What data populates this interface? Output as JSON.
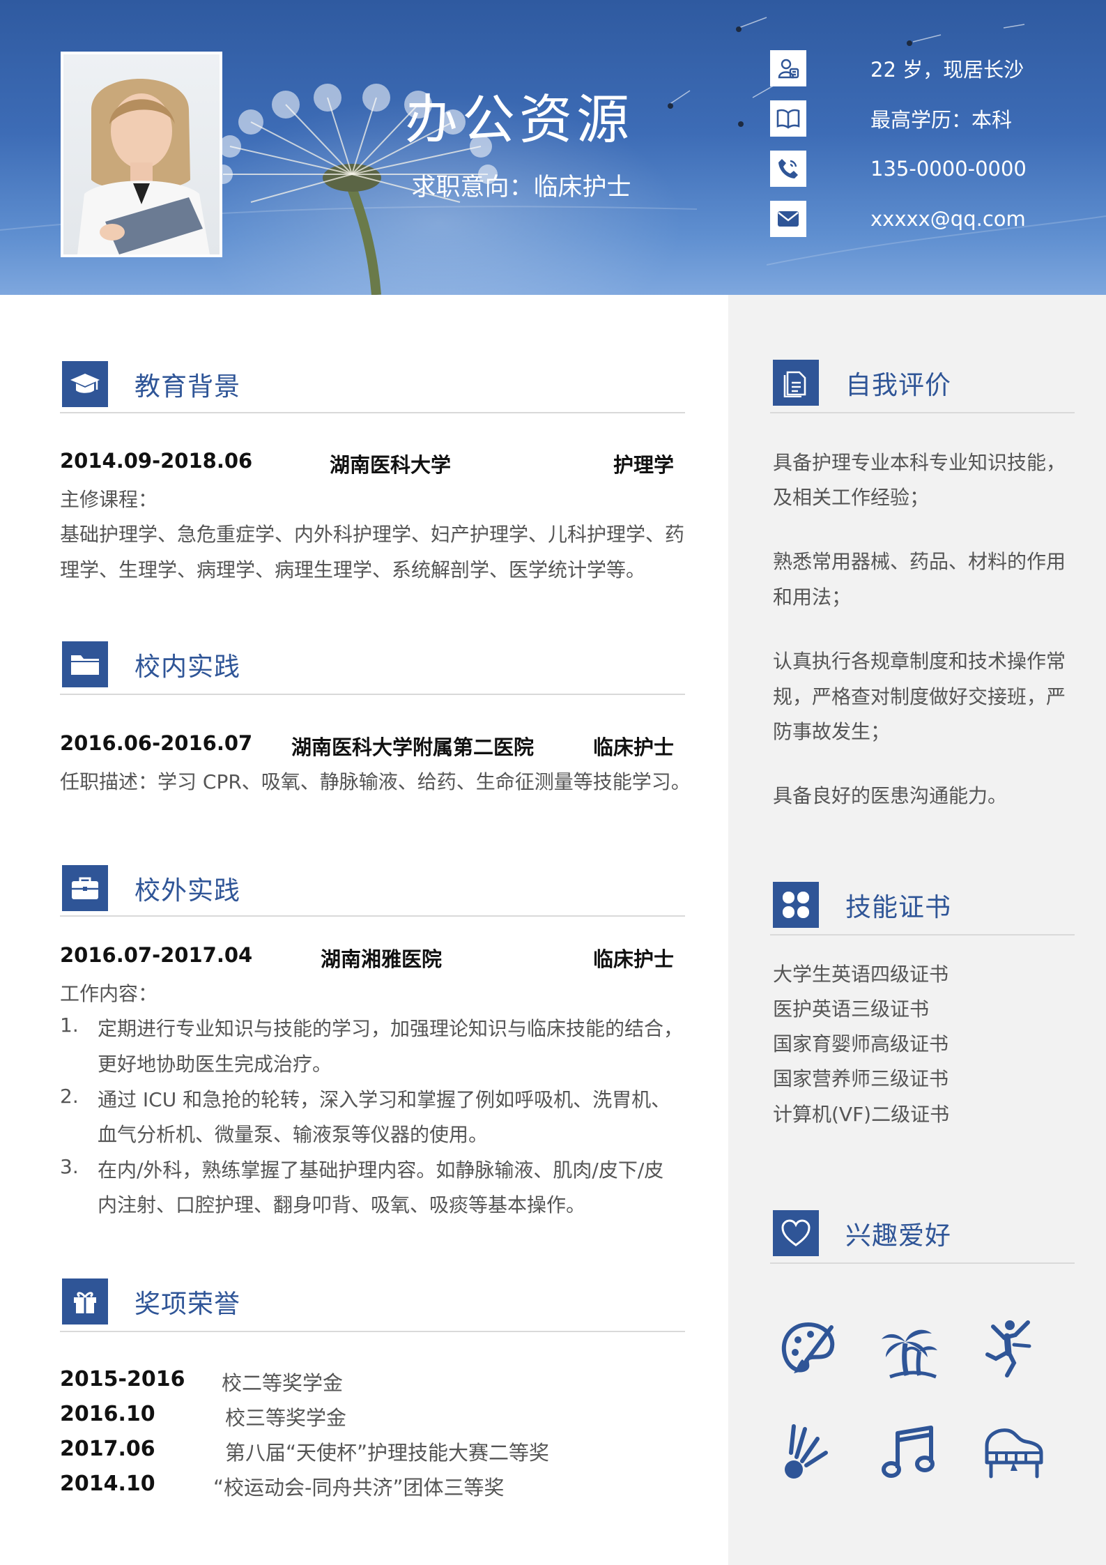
{
  "header": {
    "name": "办公资源",
    "job_intent": "求职意向：临床护士",
    "info": [
      {
        "icon": "user-id-icon",
        "text": "22 岁，现居长沙"
      },
      {
        "icon": "book-icon",
        "text": "最高学历：本科"
      },
      {
        "icon": "phone-icon",
        "text": "135-0000-0000"
      },
      {
        "icon": "mail-icon",
        "text": "xxxxx@qq.com"
      }
    ]
  },
  "education": {
    "title": "教育背景",
    "period": "2014.09-2018.06",
    "school": "湖南医科大学",
    "major": "护理学",
    "courses_label": "主修课程：",
    "courses_line1": "基础护理学、急危重症学、内外科护理学、妇产护理学、儿科护理学、药",
    "courses_line2": "理学、生理学、病理学、病理生理学、系统解剖学、医学统计学等。"
  },
  "campus": {
    "title": "校内实践",
    "period": "2016.06-2016.07",
    "org": "湖南医科大学附属第二医院",
    "role": "临床护士",
    "desc": "任职描述：学习 CPR、吸氧、静脉输液、给药、生命征测量等技能学习。"
  },
  "external": {
    "title": "校外实践",
    "period": "2016.07-2017.04",
    "org": "湖南湘雅医院",
    "role": "临床护士",
    "content_label": "工作内容：",
    "items": [
      {
        "num": "1.",
        "line1": "定期进行专业知识与技能的学习，加强理论知识与临床技能的结合，",
        "line2": "更好地协助医生完成治疗。"
      },
      {
        "num": "2.",
        "line1": "通过 ICU 和急抢的轮转，深入学习和掌握了例如呼吸机、洗胃机、",
        "line2": "血气分析机、微量泵、输液泵等仪器的使用。"
      },
      {
        "num": "3.",
        "line1": "在内/外科，熟练掌握了基础护理内容。如静脉输液、肌肉/皮下/皮",
        "line2": "内注射、口腔护理、翻身叩背、吸氧、吸痰等基本操作。"
      }
    ]
  },
  "awards": {
    "title": "奖项荣誉",
    "items": [
      {
        "date": "2015-2016",
        "name": "校二等奖学金"
      },
      {
        "date": "2016.10",
        "name": "校三等奖学金"
      },
      {
        "date": "2017.06",
        "name": "第八届“天使杯”护理技能大赛二等奖"
      },
      {
        "date": "2014.10",
        "name": "“校运动会-同舟共济”团体三等奖"
      }
    ]
  },
  "self_eval": {
    "title": "自我评价",
    "lines": [
      "具备护理专业本科专业知识技能，",
      "及相关工作经验；",
      "熟悉常用器械、药品、材料的作用",
      "和用法；",
      "认真执行各规章制度和技术操作常",
      "规，严格查对制度做好交接班，严",
      "防事故发生；",
      "具备良好的医患沟通能力。"
    ]
  },
  "skills": {
    "title": "技能证书",
    "items": [
      "大学生英语四级证书",
      "医护英语三级证书",
      "国家育婴师高级证书",
      "国家营养师三级证书",
      "计算机(VF)二级证书"
    ]
  },
  "hobbies": {
    "title": "兴趣爱好",
    "icons": [
      "palette-icon",
      "palm-tree-icon",
      "dancer-icon",
      "badminton-icon",
      "music-note-icon",
      "piano-icon"
    ]
  },
  "colors": {
    "accent": "#2f5597",
    "sidebar_bg": "#f2f2f2",
    "header_sky": "#3d6cb6"
  }
}
